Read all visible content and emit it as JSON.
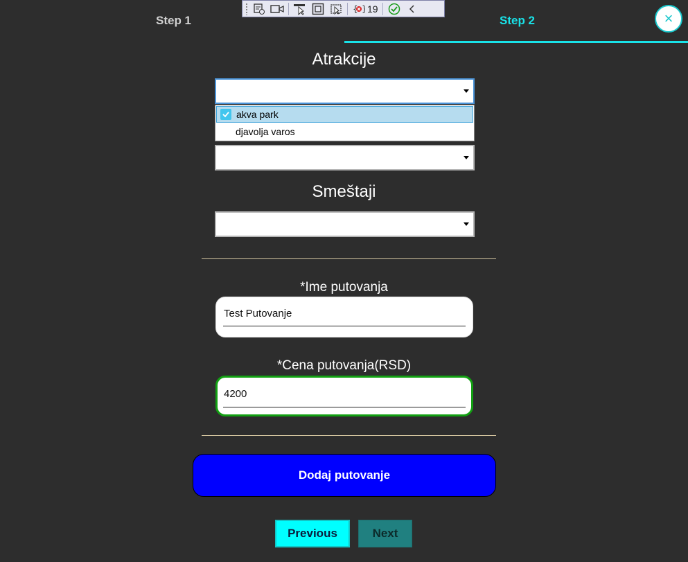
{
  "tabs": [
    {
      "label": "Step 1",
      "active": false
    },
    {
      "label": "Step 2",
      "active": true
    }
  ],
  "close_icon": "×",
  "debug_toolbar": {
    "error_count": "19",
    "icons": [
      "select-element-icon",
      "video-icon",
      "pointer-select-icon",
      "frame-icon",
      "track-focus-icon",
      "binding-failures-icon",
      "check-icon",
      "collapse-icon"
    ]
  },
  "atrakcije": {
    "title": "Atrakcije",
    "selected": "",
    "options": [
      {
        "label": "akva park",
        "checked": true
      },
      {
        "label": "djavolja varos",
        "checked": false
      }
    ]
  },
  "second_combo": {
    "selected": ""
  },
  "smestaji": {
    "title": "Smeštaji",
    "selected": ""
  },
  "ime": {
    "label": "*Ime putovanja",
    "value": "Test Putovanje"
  },
  "cena": {
    "label": "*Cena putovanja(RSD)",
    "value": "4200"
  },
  "add_button": {
    "label": "Dodaj putovanje"
  },
  "navigation": {
    "previous": "Previous",
    "next": "Next"
  },
  "colors": {
    "background": "#2d2d2d",
    "accent": "#19e2e8",
    "add_button": "#0000ff",
    "valid_border": "#12a012"
  }
}
